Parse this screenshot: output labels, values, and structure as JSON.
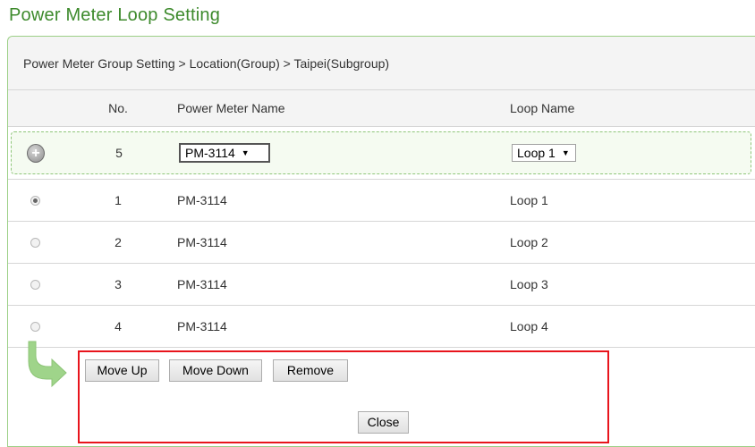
{
  "page": {
    "title": "Power Meter Loop Setting"
  },
  "breadcrumb": {
    "text": "Power Meter Group Setting > Location(Group) > Taipei(Subgroup)"
  },
  "table": {
    "headers": {
      "no": "No.",
      "name": "Power Meter Name",
      "loop": "Loop Name"
    },
    "add_row": {
      "no": "5",
      "meter_select": "PM-3114",
      "loop_select": "Loop 1"
    },
    "rows": [
      {
        "no": "1",
        "name": "PM-3114",
        "loop": "Loop 1",
        "selected": true
      },
      {
        "no": "2",
        "name": "PM-3114",
        "loop": "Loop 2",
        "selected": false
      },
      {
        "no": "3",
        "name": "PM-3114",
        "loop": "Loop 3",
        "selected": false
      },
      {
        "no": "4",
        "name": "PM-3114",
        "loop": "Loop 4",
        "selected": false
      }
    ]
  },
  "buttons": {
    "move_up": "Move Up",
    "move_down": "Move Down",
    "remove": "Remove",
    "close": "Close"
  },
  "colors": {
    "title": "#3d8a2c",
    "highlight_border": "#e8141c",
    "dashed_border": "#8fc67a"
  },
  "icons": {
    "add": "plus-circle-icon",
    "arrow": "green-curved-arrow-icon",
    "dropdown": "dropdown-arrow-icon"
  }
}
